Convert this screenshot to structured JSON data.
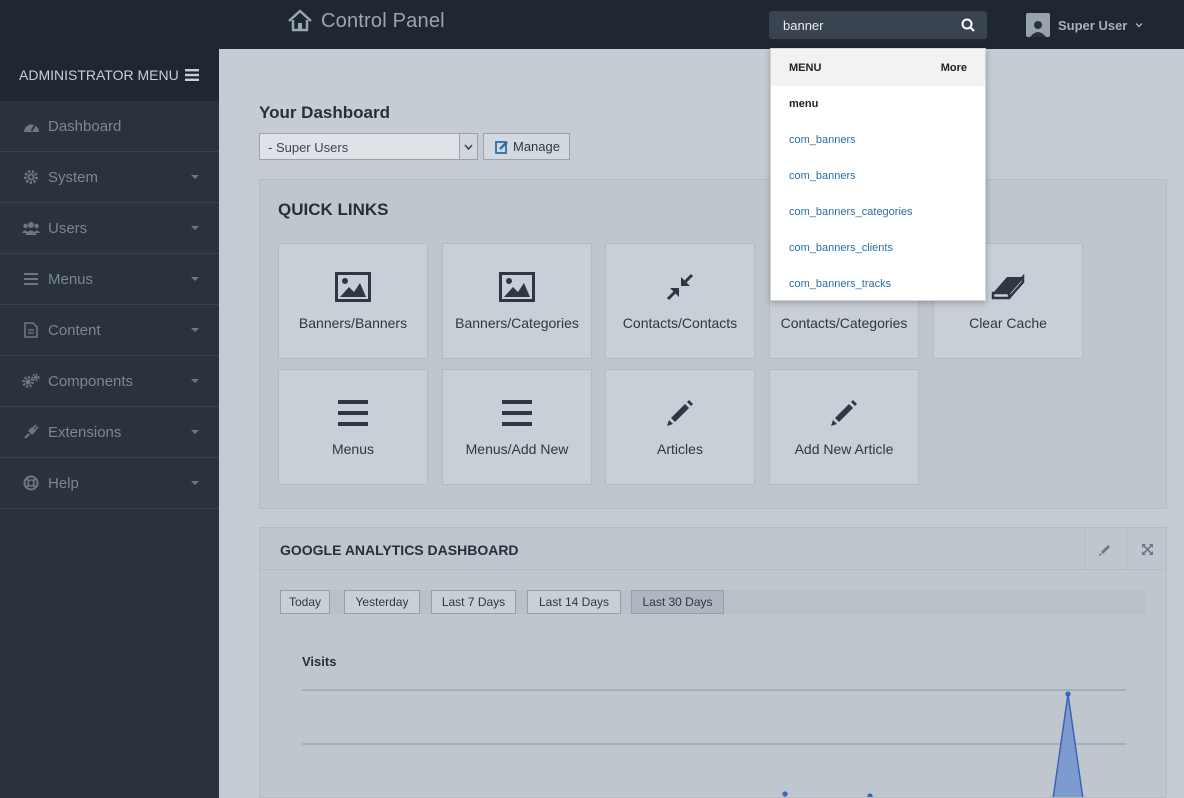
{
  "header": {
    "title": "Control Panel",
    "search_value": "banner",
    "user_name": "Super User"
  },
  "sidebar": {
    "title": "ADMINISTRATOR MENU",
    "items": [
      {
        "label": "Dashboard",
        "icon": "dashboard-icon"
      },
      {
        "label": "System",
        "icon": "gear-icon"
      },
      {
        "label": "Users",
        "icon": "users-icon"
      },
      {
        "label": "Menus",
        "icon": "list-icon"
      },
      {
        "label": "Content",
        "icon": "document-icon"
      },
      {
        "label": "Components",
        "icon": "cogs-icon"
      },
      {
        "label": "Extensions",
        "icon": "plug-icon"
      },
      {
        "label": "Help",
        "icon": "lifebuoy-icon"
      }
    ]
  },
  "dashboard": {
    "title": "Your Dashboard",
    "select_value": "- Super Users",
    "manage_label": "Manage"
  },
  "quick_links": {
    "title": "QUICK LINKS",
    "tiles": [
      {
        "label": "Banners/Banners",
        "icon": "image-icon"
      },
      {
        "label": "Banners/Categories",
        "icon": "image-icon"
      },
      {
        "label": "Contacts/Contacts",
        "icon": "compress-icon"
      },
      {
        "label": "Contacts/Categories",
        "icon": "compress-icon"
      },
      {
        "label": "Clear Cache",
        "icon": "eraser-icon"
      },
      {
        "label": "Menus",
        "icon": "list-icon"
      },
      {
        "label": "Menus/Add New",
        "icon": "list-icon"
      },
      {
        "label": "Articles",
        "icon": "pencil-icon"
      },
      {
        "label": "Add New Article",
        "icon": "pencil-icon"
      }
    ]
  },
  "analytics": {
    "title": "GOOGLE ANALYTICS DASHBOARD",
    "ranges": [
      "Today",
      "Yesterday",
      "Last 7 Days",
      "Last 14 Days",
      "Last 30 Days"
    ],
    "active_range": "Last 30 Days",
    "chart_label": "Visits"
  },
  "search_dropdown": {
    "header_label": "MENU",
    "more_label": "More",
    "items": [
      "menu",
      "com_banners",
      "com_banners",
      "com_banners_categories",
      "com_banners_clients",
      "com_banners_tracks"
    ]
  },
  "colors": {
    "topbar": "#1f2731",
    "sidebar": "#2a323c",
    "link": "#2a6fa8",
    "chart_line": "#3a66b5"
  }
}
